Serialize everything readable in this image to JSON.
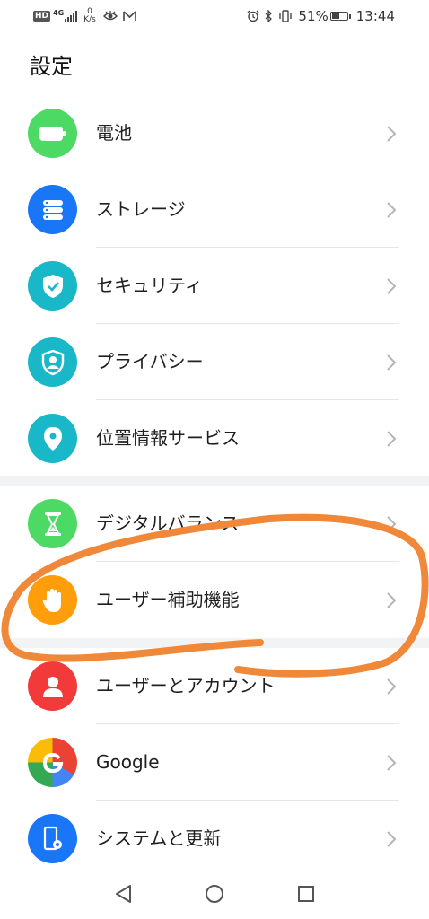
{
  "status_bar": {
    "hd": "HD",
    "network": "4G",
    "speed_value": "0",
    "speed_unit": "K/s",
    "battery_percent": "51%",
    "battery_level": 0.51,
    "time": "13:44"
  },
  "page_title": "設定",
  "items": [
    {
      "label": "電池",
      "icon": "battery-icon",
      "color": "#4cd964"
    },
    {
      "label": "ストレージ",
      "icon": "storage-icon",
      "color": "#1976f7"
    },
    {
      "label": "セキュリティ",
      "icon": "shield-check-icon",
      "color": "#19b8c8"
    },
    {
      "label": "プライバシー",
      "icon": "privacy-icon",
      "color": "#19b8c8"
    },
    {
      "label": "位置情報サービス",
      "icon": "location-pin-icon",
      "color": "#19b8c8"
    },
    {
      "label": "デジタルバランス",
      "icon": "hourglass-icon",
      "color": "#4cd964"
    },
    {
      "label": "ユーザー補助機能",
      "icon": "hand-icon",
      "color": "#ff9d0a"
    },
    {
      "label": "ユーザーとアカウント",
      "icon": "user-icon",
      "color": "#f23a3a"
    },
    {
      "label": "Google",
      "icon": "google-icon",
      "color": "#ffffff"
    },
    {
      "label": "システムと更新",
      "icon": "system-update-icon",
      "color": "#1976f7"
    }
  ],
  "annotation_color": "#f0883a",
  "nav": {
    "back": "back-icon",
    "home": "home-icon",
    "recents": "recents-icon"
  }
}
